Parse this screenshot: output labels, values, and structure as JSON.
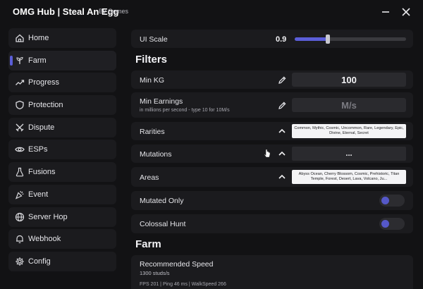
{
  "window": {
    "title": "OMG Hub | Steal An Egg",
    "author": "By Gomes"
  },
  "sidebar": {
    "active_index": 1,
    "items": [
      {
        "label": "Home",
        "icon": "home-icon"
      },
      {
        "label": "Farm",
        "icon": "sprout-icon"
      },
      {
        "label": "Progress",
        "icon": "trend-up-icon"
      },
      {
        "label": "Protection",
        "icon": "shield-icon"
      },
      {
        "label": "Dispute",
        "icon": "crossed-swords-icon"
      },
      {
        "label": "ESPs",
        "icon": "eye-icon"
      },
      {
        "label": "Fusions",
        "icon": "flask-icon"
      },
      {
        "label": "Event",
        "icon": "party-popper-icon"
      },
      {
        "label": "Server Hop",
        "icon": "globe-icon"
      },
      {
        "label": "Webhook",
        "icon": "bell-icon"
      },
      {
        "label": "Config",
        "icon": "gear-icon"
      }
    ]
  },
  "ui_scale": {
    "label": "UI Scale",
    "value": "0.9",
    "fraction": 0.3
  },
  "filters": {
    "title": "Filters",
    "min_kg": {
      "label": "Min KG",
      "value": "100"
    },
    "min_earnings": {
      "label": "Min Earnings",
      "hint": "in millions per second - type 10 for 10M/s",
      "placeholder": "M/s"
    },
    "rarities": {
      "label": "Rarities",
      "selected": "Common, Mythic, Cosmic, Uncommon, Rare, Legendary, Epic, Divine, Eternal, Secret"
    },
    "mutations": {
      "label": "Mutations",
      "selected": "..."
    },
    "areas": {
      "label": "Areas",
      "selected": "Abyss Ocean, Cherry Blossom, Cosmic, Prehistoric, Titan Temple, Forest, Desert, Lava, Volcano, Ju..."
    },
    "mutated_only": {
      "label": "Mutated Only"
    },
    "colossal_hunt": {
      "label": "Colossal Hunt"
    }
  },
  "farm": {
    "title": "Farm",
    "recommended_speed": {
      "label": "Recommended Speed",
      "value": "1300 studs/s",
      "status": "FPS 201  |  Ping 46 ms  |  WalkSpeed 266"
    }
  },
  "colors": {
    "accent": "#5b5ed8",
    "panel": "#1b1b1e",
    "background": "#121214"
  }
}
